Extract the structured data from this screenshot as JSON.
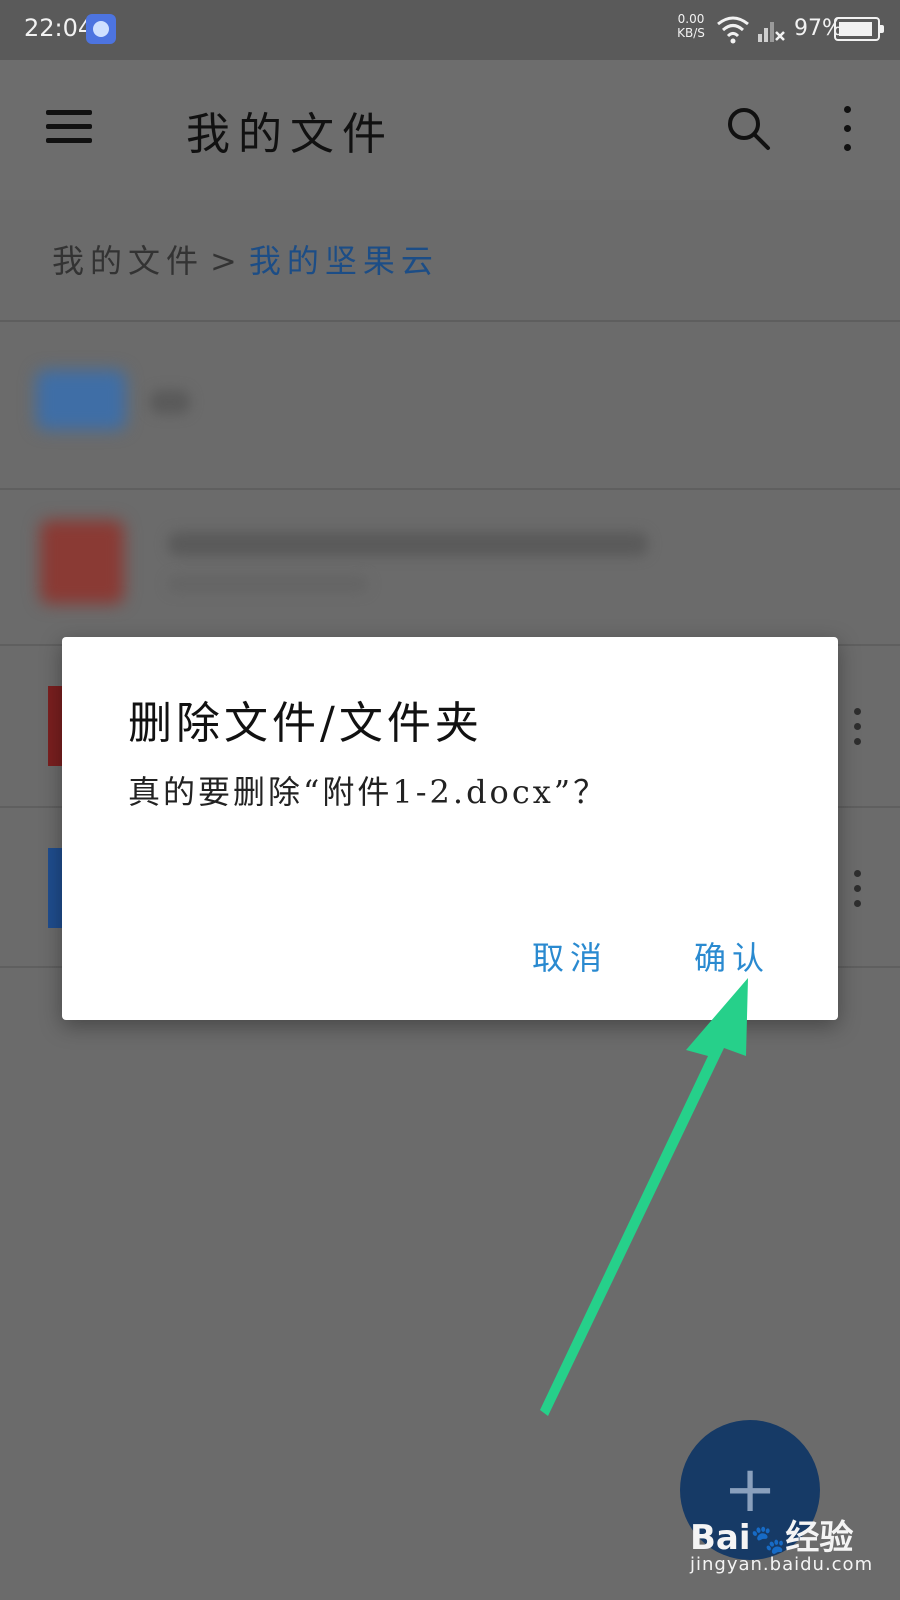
{
  "status_bar": {
    "time": "22:04",
    "net_speed": "0.00",
    "net_unit": "KB/S",
    "battery_pct": "97%",
    "battery_level": 0.97
  },
  "header": {
    "title": "我的文件"
  },
  "breadcrumb": {
    "root": "我的文件",
    "separator": ">",
    "current": "我的坚果云"
  },
  "dialog": {
    "title": "删除文件/文件夹",
    "message": "真的要删除“附件1-2.docx”？",
    "cancel_label": "取消",
    "confirm_label": "确认"
  },
  "fab": {
    "icon": "plus-icon"
  },
  "watermark": {
    "brand": "Bai",
    "brand_suffix": "经验",
    "site": "jingyan.baidu.com"
  },
  "colors": {
    "accent": "#2a8ad0",
    "breadcrumb_current": "#1c4d86",
    "arrow": "#26d08a",
    "fab": "#163a66"
  }
}
